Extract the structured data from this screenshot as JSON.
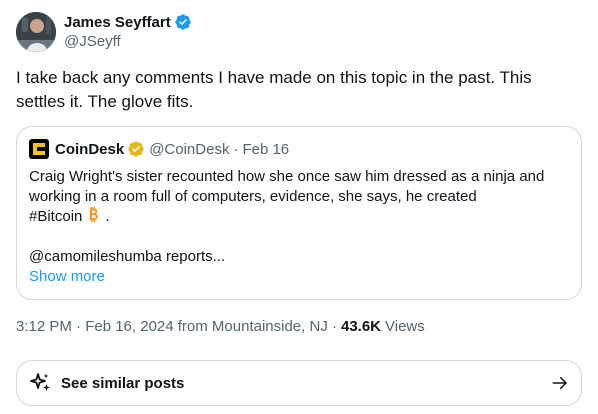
{
  "author": {
    "display_name": "James Seyffart",
    "handle": "@JSeyff",
    "verified_icon": "verified-badge-icon",
    "verified_color": "#1d9bf0"
  },
  "tweet": {
    "text": "I take back any comments I have made on this topic in the past. This settles it. The glove fits."
  },
  "quote": {
    "display_name": "CoinDesk",
    "handle": "@CoinDesk",
    "separator": "·",
    "date": "Feb 16",
    "badge_color": "#e2b719",
    "logo_color": "#f5c518",
    "body_lines": [
      "Craig Wright's sister recounted how she once saw him dressed as a ninja and",
      "working in a room full of computers, evidence, she says, he created"
    ],
    "hashtag": "#Bitcoin",
    "hashtag_suffix": ".",
    "mention_line": "@camomileshumba reports...",
    "show_more": "Show more"
  },
  "meta": {
    "timestamp": "3:12 PM · Feb 16, 2024 from Mountainside, NJ ·",
    "views_count": "43.6K",
    "views_label": "Views"
  },
  "similar_posts": {
    "label": "See similar posts"
  },
  "colors": {
    "text_primary": "#0f1419",
    "text_secondary": "#536471",
    "link": "#1d9bf0",
    "border": "#cfd9de",
    "bitcoin": "#f7931a"
  }
}
